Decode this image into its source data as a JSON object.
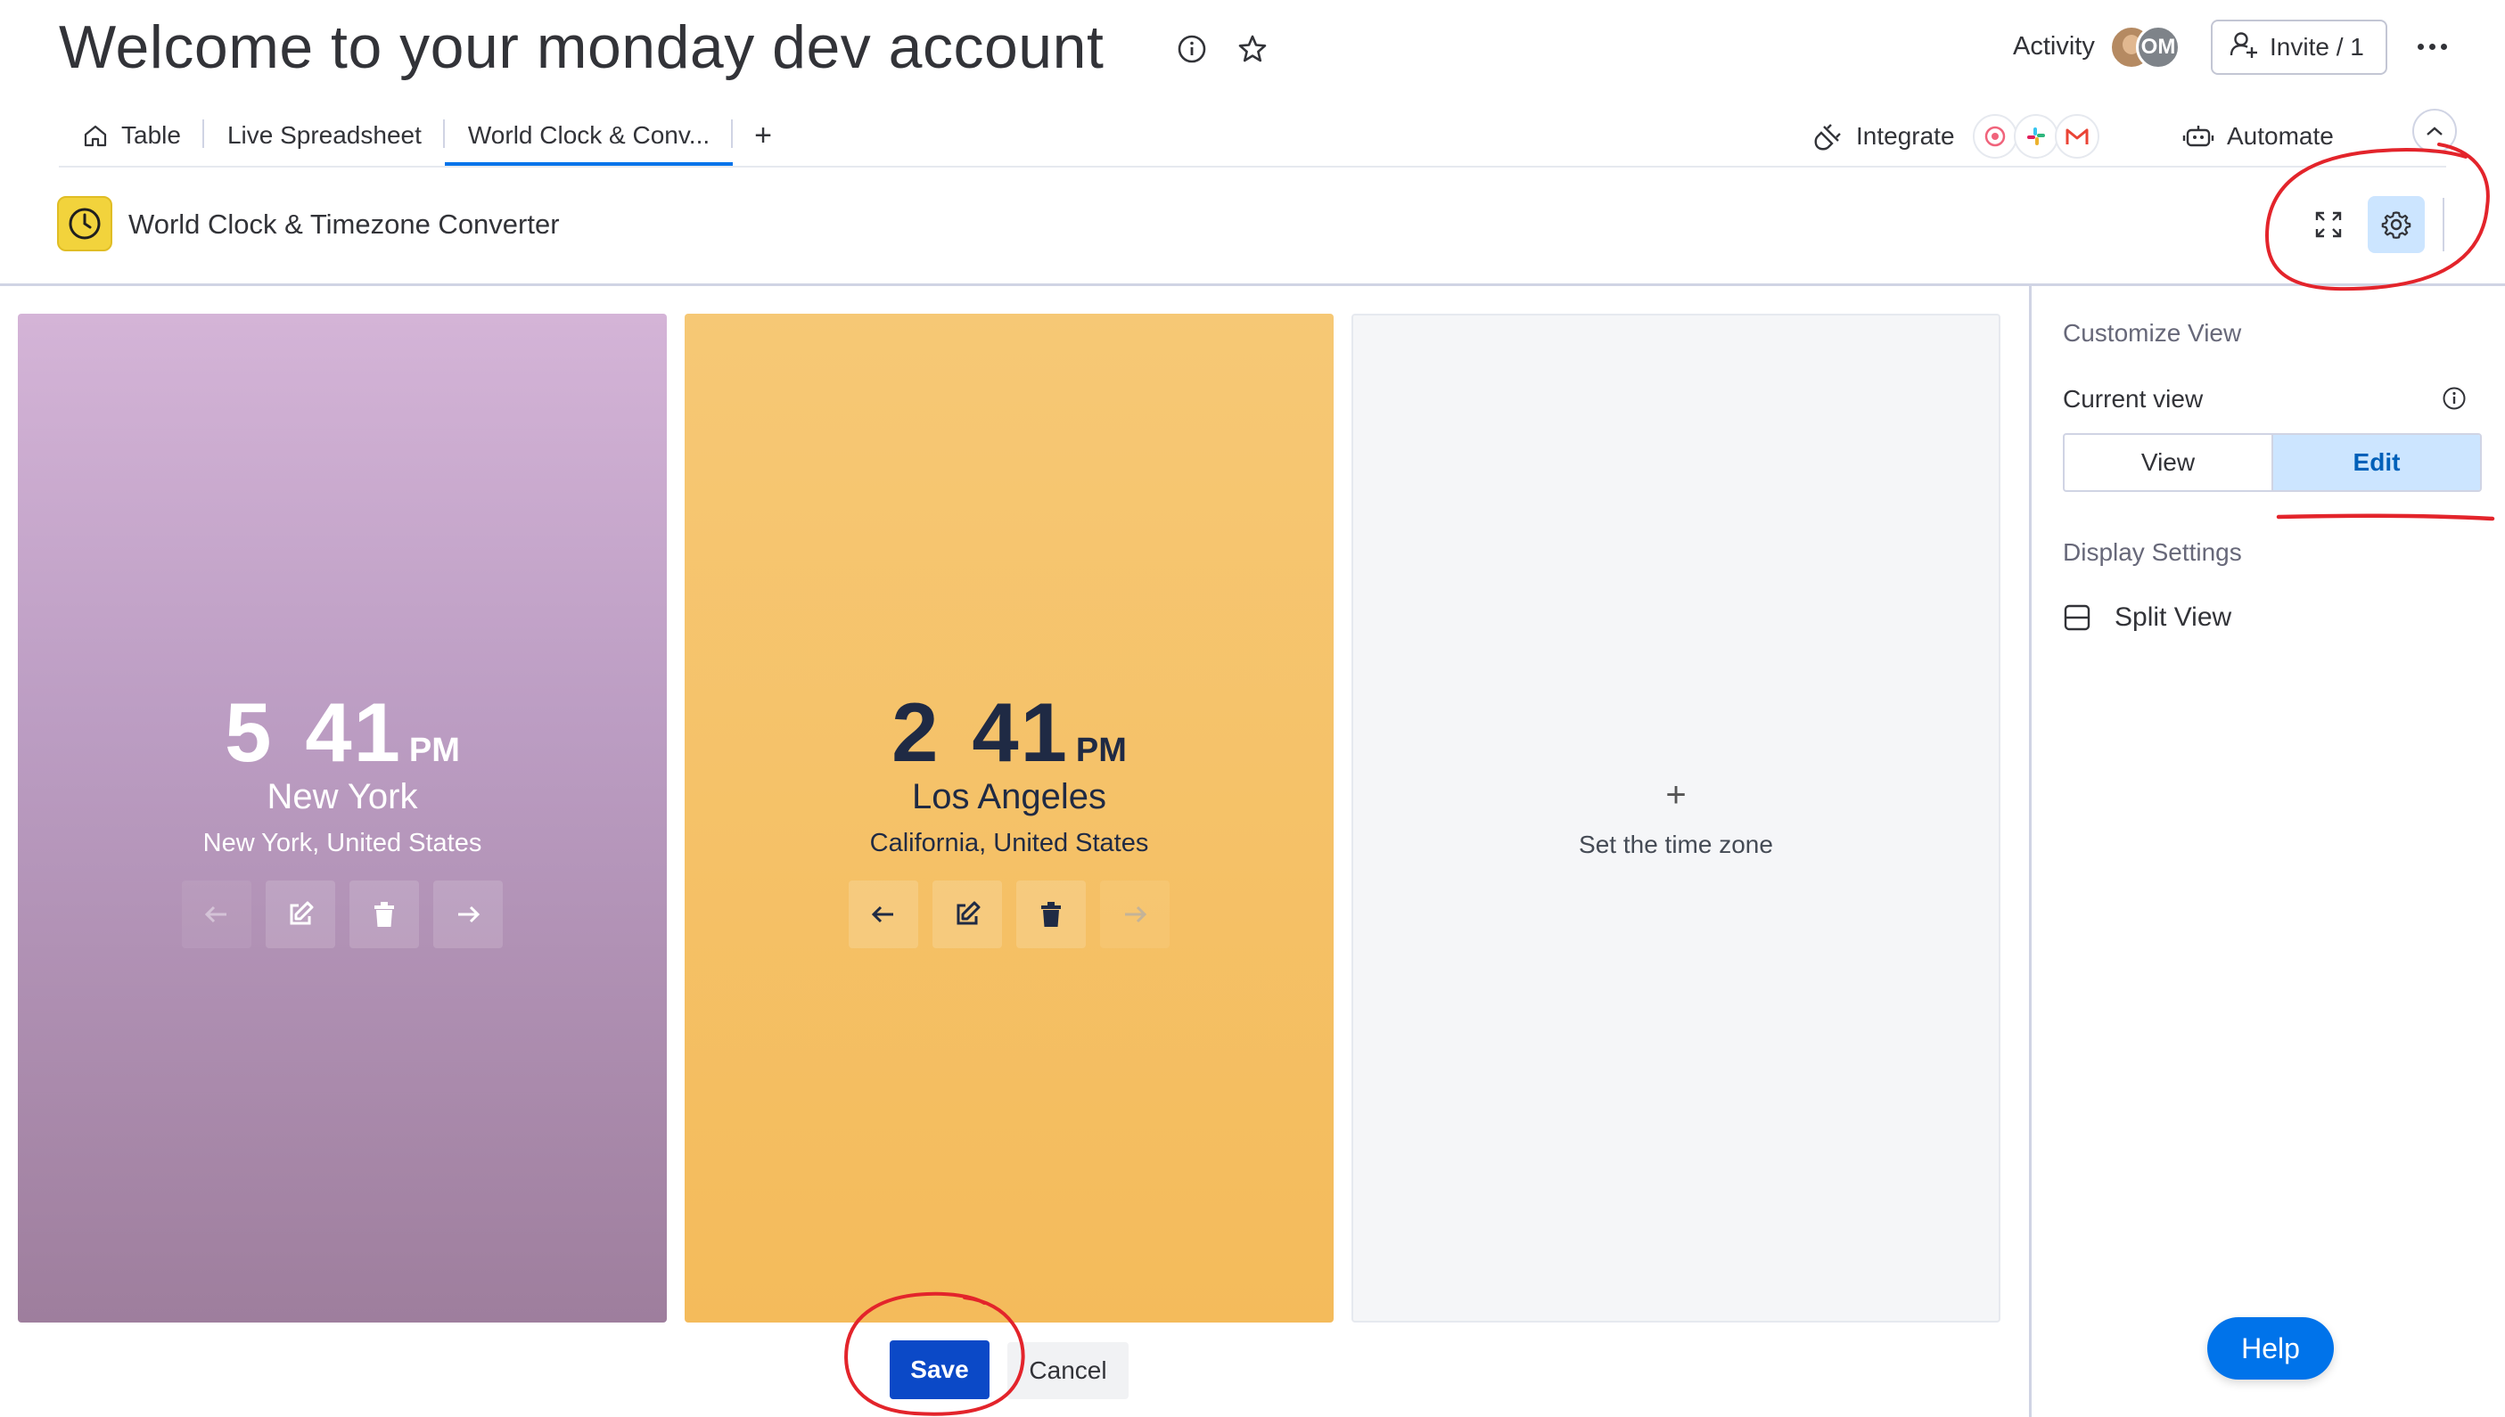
{
  "header": {
    "title": "Welcome to your monday dev account",
    "activity_label": "Activity",
    "avatar_initials": "OM",
    "invite_label": "Invite / 1"
  },
  "tabs": [
    {
      "label": "Table",
      "icon": "home-icon",
      "active": false
    },
    {
      "label": "Live Spreadsheet",
      "active": false
    },
    {
      "label": "World Clock & Conv...",
      "active": true
    }
  ],
  "toolbar": {
    "add_tab": "+",
    "integrate_label": "Integrate",
    "integration_icons": [
      "monday-icon",
      "slack-icon",
      "gmail-icon"
    ],
    "automate_label": "Automate"
  },
  "app": {
    "title": "World Clock & Timezone Converter",
    "icon": "clock-icon"
  },
  "clocks": [
    {
      "hour": "5",
      "minute": "41",
      "ampm": "PM",
      "city": "New York",
      "region": "New York, United States",
      "prev_enabled": false,
      "next_enabled": true
    },
    {
      "hour": "2",
      "minute": "41",
      "ampm": "PM",
      "city": "Los Angeles",
      "region": "California, United States",
      "prev_enabled": true,
      "next_enabled": false
    }
  ],
  "empty_slot": {
    "plus": "+",
    "label": "Set the time zone"
  },
  "actions": {
    "save": "Save",
    "cancel": "Cancel"
  },
  "panel": {
    "customize_heading": "Customize View",
    "current_view_label": "Current view",
    "view_option": "View",
    "edit_option": "Edit",
    "selected": "Edit",
    "display_heading": "Display Settings",
    "split_view_label": "Split View"
  },
  "help_label": "Help",
  "colors": {
    "accent": "#0073ea",
    "save": "#0b49c7",
    "ny_card_top": "#d4b4d7",
    "ny_card_bottom": "#9e7e9d",
    "la_card": "#f4bb5b",
    "annotation": "#e3242b"
  }
}
